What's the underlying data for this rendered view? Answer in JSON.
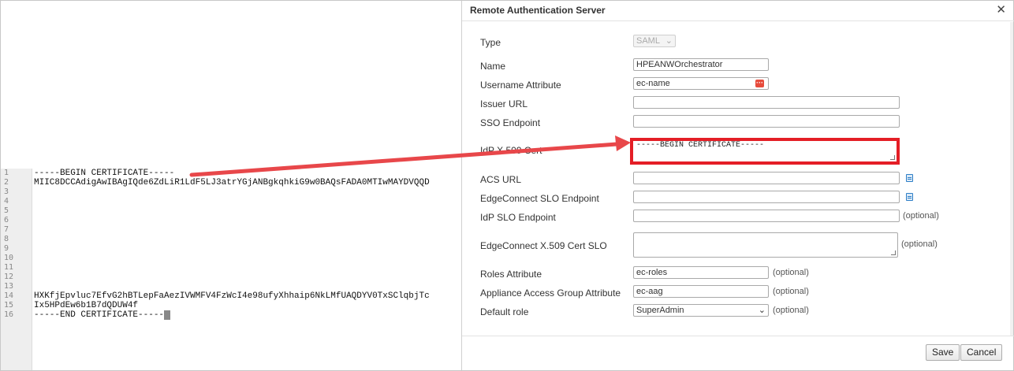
{
  "dialog": {
    "title": "Remote Authentication Server",
    "close_glyph": "✕",
    "fields": {
      "type": {
        "label": "Type",
        "value": "SAML"
      },
      "name": {
        "label": "Name",
        "value": "HPEANWOrchestrator"
      },
      "username_attribute": {
        "label": "Username Attribute",
        "value": "ec-name"
      },
      "issuer_url": {
        "label": "Issuer URL",
        "value": ""
      },
      "sso_endpoint": {
        "label": "SSO Endpoint",
        "value": ""
      },
      "idp_cert": {
        "label": "IdP X.509 Cert",
        "value": "-----BEGIN CERTIFICATE-----"
      },
      "acs_url": {
        "label": "ACS URL",
        "value": ""
      },
      "edgeconnect_slo_endpoint": {
        "label": "EdgeConnect SLO Endpoint",
        "value": ""
      },
      "idp_slo_endpoint": {
        "label": "IdP SLO Endpoint",
        "value": ""
      },
      "edgeconnect_cert_slo": {
        "label": "EdgeConnect X.509 Cert SLO",
        "value": ""
      },
      "roles_attribute": {
        "label": "Roles Attribute",
        "value": "ec-roles"
      },
      "appliance_access_group_attribute": {
        "label": "Appliance Access Group Attribute",
        "value": "ec-aag"
      },
      "default_role": {
        "label": "Default role",
        "value": "SuperAdmin"
      }
    },
    "optional_text": "(optional)",
    "save_label": "Save",
    "cancel_label": "Cancel"
  },
  "editor": {
    "lines": [
      {
        "num": "1",
        "text": "-----BEGIN CERTIFICATE-----"
      },
      {
        "num": "2",
        "text": "MIIC8DCCAdigAwIBAgIQde6ZdLiR1LdF5LJ3atrYGjANBgkqhkiG9w0BAQsFADA0MTIwMAYDVQQD"
      },
      {
        "num": "3",
        "text": ""
      },
      {
        "num": "4",
        "text": ""
      },
      {
        "num": "5",
        "text": ""
      },
      {
        "num": "6",
        "text": ""
      },
      {
        "num": "7",
        "text": ""
      },
      {
        "num": "8",
        "text": ""
      },
      {
        "num": "9",
        "text": ""
      },
      {
        "num": "10",
        "text": ""
      },
      {
        "num": "11",
        "text": ""
      },
      {
        "num": "12",
        "text": ""
      },
      {
        "num": "13",
        "text": ""
      },
      {
        "num": "14",
        "text": "HXKfjEpvluc7EfvG2hBTLepFaAezIVWMFV4FzWcI4e98ufyXhhaip6NkLMfUAQDYV0TxSClqbjTc"
      },
      {
        "num": "15",
        "text": "Ix5HPdEw6b1B7dQDUW4f"
      },
      {
        "num": "16",
        "text": "-----END CERTIFICATE-----"
      }
    ]
  },
  "colors": {
    "highlight": "#e41e26",
    "arrow": "#e8474a"
  }
}
